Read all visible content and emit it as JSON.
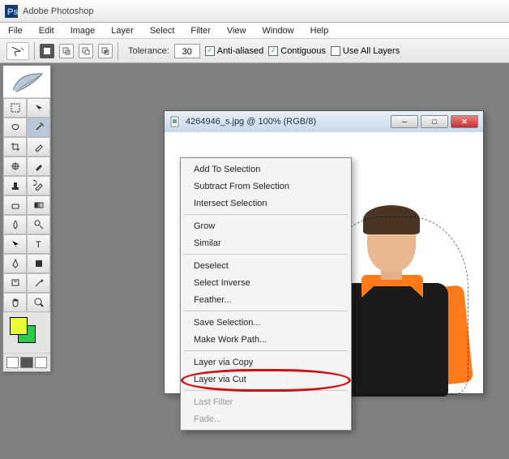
{
  "app": {
    "title": "Adobe Photoshop"
  },
  "menu": {
    "file": "File",
    "edit": "Edit",
    "image": "Image",
    "layer": "Layer",
    "select": "Select",
    "filter": "Filter",
    "view": "View",
    "window": "Window",
    "help": "Help"
  },
  "options": {
    "tolerance_label": "Tolerance:",
    "tolerance": "30",
    "anti_aliased": "Anti-aliased",
    "contiguous": "Contiguous",
    "use_all_layers": "Use All Layers",
    "anti_aliased_checked": true,
    "contiguous_checked": true,
    "use_all_layers_checked": false
  },
  "document": {
    "title": "4264946_s.jpg @ 100% (RGB/8)"
  },
  "context_menu": {
    "add": "Add To Selection",
    "subtract": "Subtract From Selection",
    "intersect": "Intersect Selection",
    "grow": "Grow",
    "similar": "Similar",
    "deselect": "Deselect",
    "inverse": "Select Inverse",
    "feather": "Feather...",
    "save": "Save Selection...",
    "workpath": "Make Work Path...",
    "layer_copy": "Layer via Copy",
    "layer_cut": "Layer via Cut",
    "last_filter": "Last Filter",
    "fade": "Fade..."
  }
}
